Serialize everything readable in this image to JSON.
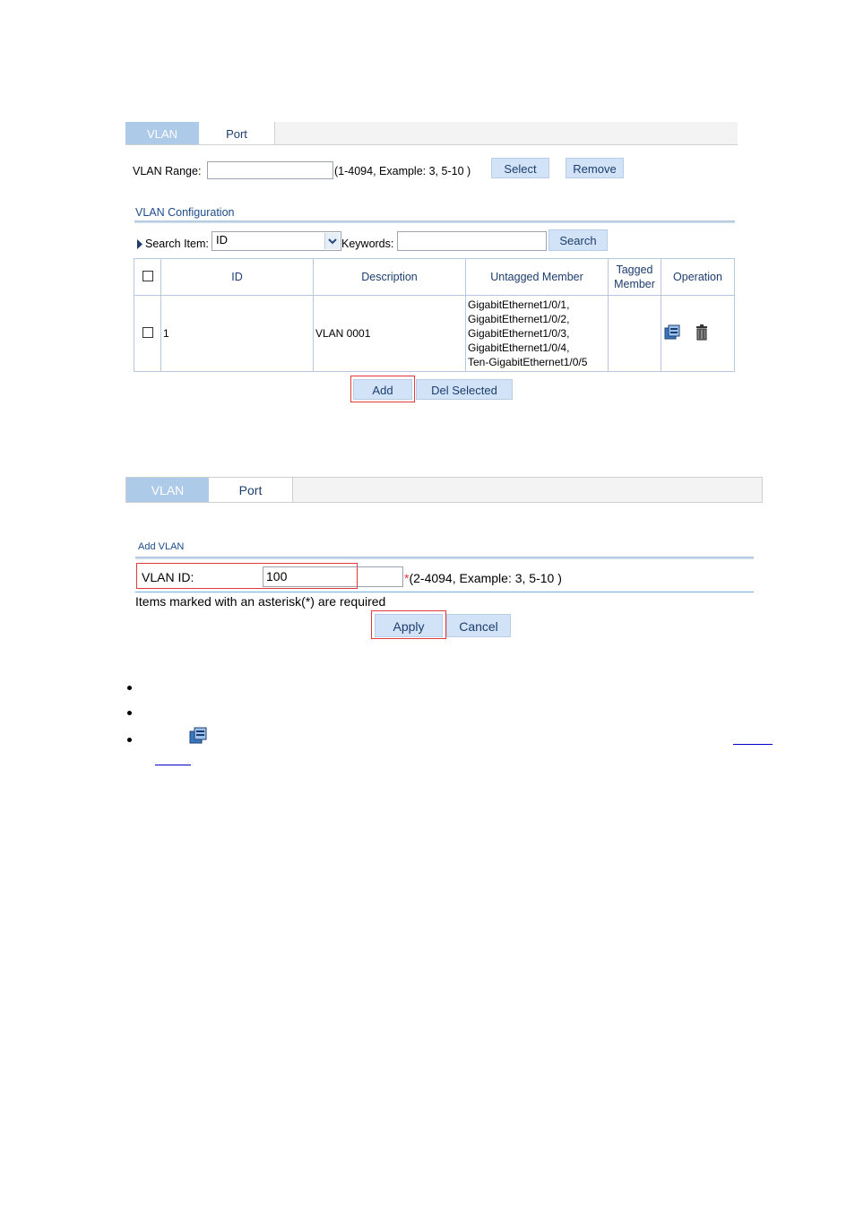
{
  "screen1": {
    "tabs": [
      "VLAN",
      "Port"
    ],
    "vlan_range": {
      "label": "VLAN Range:",
      "value": "",
      "hint": "(1-4094, Example: 3, 5-10 )",
      "select_label": "Select",
      "remove_label": "Remove"
    },
    "section_title": "VLAN Configuration",
    "search": {
      "item_label": "Search Item:",
      "item_value": "ID",
      "keywords_label": "Keywords:",
      "keywords_value": "",
      "button_label": "Search"
    },
    "table": {
      "headers": [
        "ID",
        "Description",
        "Untagged Member",
        "Tagged\nMember",
        "Operation"
      ],
      "rows": [
        {
          "id": "1",
          "description": "VLAN 0001",
          "untagged": "GigabitEthernet1/0/1,\nGigabitEthernet1/0/2,\nGigabitEthernet1/0/3,\nGigabitEthernet1/0/4,\nTen-GigabitEthernet1/0/5",
          "tagged": ""
        }
      ]
    },
    "add_label": "Add",
    "del_selected_label": "Del Selected"
  },
  "screen2": {
    "tabs": [
      "VLAN",
      "Port"
    ],
    "section_title": "Add VLAN",
    "vlan_id_label": "VLAN ID:",
    "vlan_id_value": "100",
    "asterisk": "*",
    "vlan_id_hint": "(2-4094, Example: 3, 5-10 )",
    "required_note": "Items marked with an asterisk(*) are required",
    "apply_label": "Apply",
    "cancel_label": "Cancel"
  },
  "colors": {
    "tab_active": "#aecae9",
    "button_bg": "#d2e3f7",
    "highlight_box": "#e0383b"
  }
}
